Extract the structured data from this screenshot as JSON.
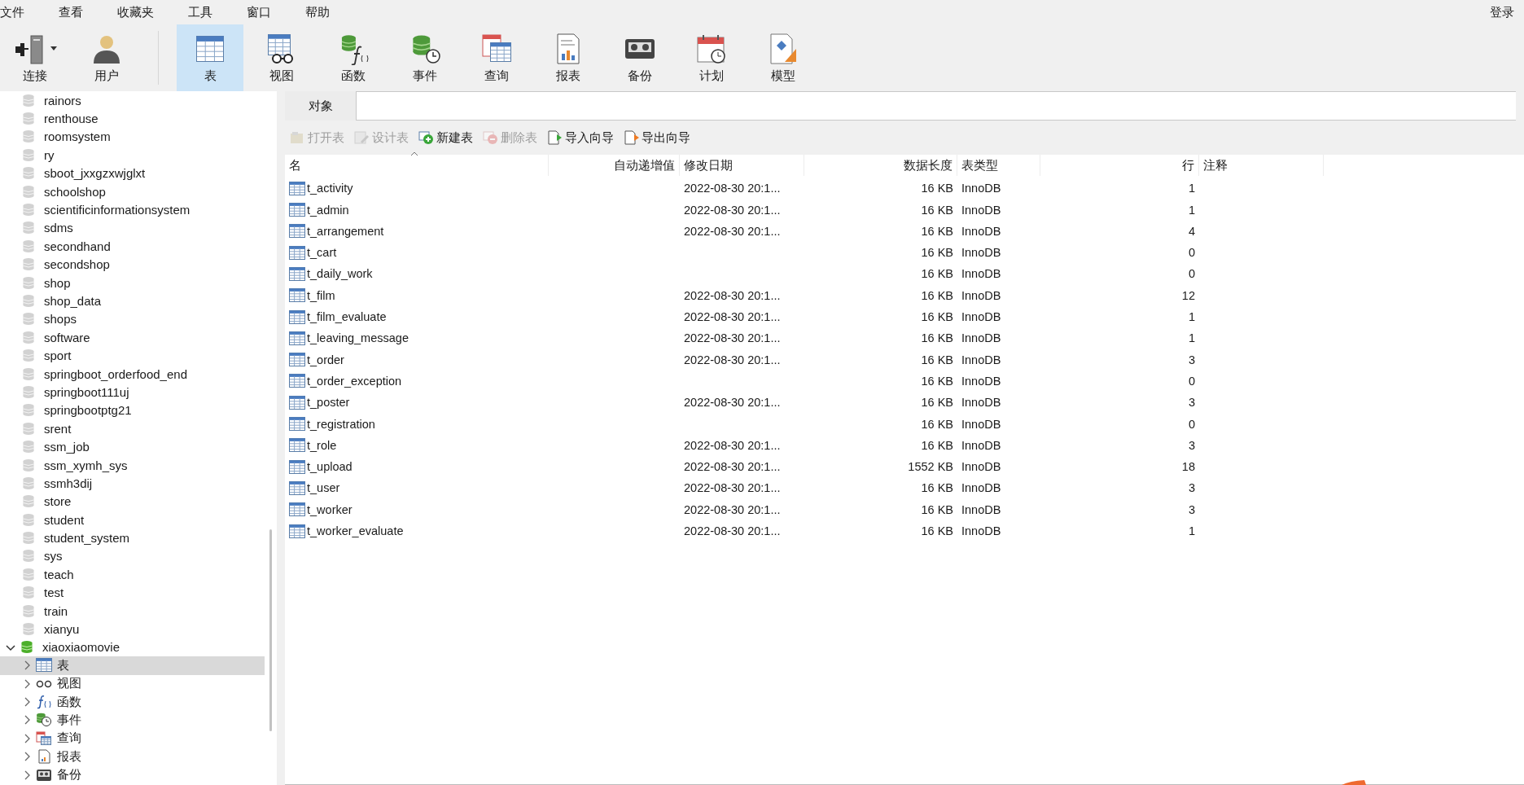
{
  "menu": [
    "文件",
    "查看",
    "收藏夹",
    "工具",
    "窗口",
    "帮助"
  ],
  "account": "登录",
  "toolbar": [
    {
      "label": "连接",
      "kind": "connect",
      "selected": false,
      "dropdown": true
    },
    {
      "label": "用户",
      "kind": "user",
      "selected": false
    },
    {
      "label": "表",
      "kind": "table",
      "selected": true
    },
    {
      "label": "视图",
      "kind": "view",
      "selected": false
    },
    {
      "label": "函数",
      "kind": "function",
      "selected": false
    },
    {
      "label": "事件",
      "kind": "event",
      "selected": false
    },
    {
      "label": "查询",
      "kind": "query",
      "selected": false
    },
    {
      "label": "报表",
      "kind": "report",
      "selected": false
    },
    {
      "label": "备份",
      "kind": "backup",
      "selected": false
    },
    {
      "label": "计划",
      "kind": "schedule",
      "selected": false
    },
    {
      "label": "模型",
      "kind": "model",
      "selected": false
    }
  ],
  "sidebar": {
    "databases": [
      {
        "name": "rainors",
        "expanded": false
      },
      {
        "name": "renthouse",
        "expanded": false
      },
      {
        "name": "roomsystem",
        "expanded": false
      },
      {
        "name": "ry",
        "expanded": false
      },
      {
        "name": "sboot_jxxgzxwjglxt",
        "expanded": false
      },
      {
        "name": "schoolshop",
        "expanded": false
      },
      {
        "name": "scientificinformationsystem",
        "expanded": false
      },
      {
        "name": "sdms",
        "expanded": false
      },
      {
        "name": "secondhand",
        "expanded": false
      },
      {
        "name": "secondshop",
        "expanded": false
      },
      {
        "name": "shop",
        "expanded": false
      },
      {
        "name": "shop_data",
        "expanded": false
      },
      {
        "name": "shops",
        "expanded": false
      },
      {
        "name": "software",
        "expanded": false
      },
      {
        "name": "sport",
        "expanded": false
      },
      {
        "name": "springboot_orderfood_end",
        "expanded": false
      },
      {
        "name": "springboot111uj",
        "expanded": false
      },
      {
        "name": "springbootptg21",
        "expanded": false
      },
      {
        "name": "srent",
        "expanded": false
      },
      {
        "name": "ssm_job",
        "expanded": false
      },
      {
        "name": "ssm_xymh_sys",
        "expanded": false
      },
      {
        "name": "ssmh3dij",
        "expanded": false
      },
      {
        "name": "store",
        "expanded": false
      },
      {
        "name": "student",
        "expanded": false
      },
      {
        "name": "student_system",
        "expanded": false
      },
      {
        "name": "sys",
        "expanded": false
      },
      {
        "name": "teach",
        "expanded": false
      },
      {
        "name": "test",
        "expanded": false
      },
      {
        "name": "train",
        "expanded": false
      },
      {
        "name": "xianyu",
        "expanded": false
      },
      {
        "name": "xiaoxiaomovie",
        "expanded": true,
        "children": [
          {
            "label": "表",
            "kind": "table",
            "selected": true,
            "expanded": false
          },
          {
            "label": "视图",
            "kind": "view",
            "selected": false,
            "expanded": false
          },
          {
            "label": "函数",
            "kind": "function",
            "selected": false,
            "expanded": false
          },
          {
            "label": "事件",
            "kind": "event",
            "selected": false,
            "expanded": false
          },
          {
            "label": "查询",
            "kind": "query",
            "selected": false,
            "expanded": false
          },
          {
            "label": "报表",
            "kind": "report",
            "selected": false,
            "expanded": false
          },
          {
            "label": "备份",
            "kind": "backup",
            "selected": false,
            "expanded": false
          }
        ]
      }
    ]
  },
  "object_tab": {
    "label": "对象",
    "selected": true
  },
  "actions": [
    {
      "label": "打开表",
      "kind": "open",
      "disabled": true
    },
    {
      "label": "设计表",
      "kind": "design",
      "disabled": true
    },
    {
      "label": "新建表",
      "kind": "new",
      "disabled": false
    },
    {
      "label": "删除表",
      "kind": "delete",
      "disabled": true
    },
    {
      "label": "导入向导",
      "kind": "import",
      "disabled": false
    },
    {
      "label": "导出向导",
      "kind": "export",
      "disabled": false
    }
  ],
  "table": {
    "columns": [
      "名",
      "自动递增值",
      "修改日期",
      "数据长度",
      "表类型",
      "行",
      "注释"
    ],
    "rows": [
      {
        "name": "t_activity",
        "modified": "2022-08-30 20:1...",
        "data_length": "16 KB",
        "engine": "InnoDB",
        "rows": "1"
      },
      {
        "name": "t_admin",
        "modified": "2022-08-30 20:1...",
        "data_length": "16 KB",
        "engine": "InnoDB",
        "rows": "1"
      },
      {
        "name": "t_arrangement",
        "modified": "2022-08-30 20:1...",
        "data_length": "16 KB",
        "engine": "InnoDB",
        "rows": "4"
      },
      {
        "name": "t_cart",
        "data_length": "16 KB",
        "engine": "InnoDB",
        "rows": "0"
      },
      {
        "name": "t_daily_work",
        "data_length": "16 KB",
        "engine": "InnoDB",
        "rows": "0"
      },
      {
        "name": "t_film",
        "modified": "2022-08-30 20:1...",
        "data_length": "16 KB",
        "engine": "InnoDB",
        "rows": "12"
      },
      {
        "name": "t_film_evaluate",
        "modified": "2022-08-30 20:1...",
        "data_length": "16 KB",
        "engine": "InnoDB",
        "rows": "1"
      },
      {
        "name": "t_leaving_message",
        "modified": "2022-08-30 20:1...",
        "data_length": "16 KB",
        "engine": "InnoDB",
        "rows": "1"
      },
      {
        "name": "t_order",
        "modified": "2022-08-30 20:1...",
        "data_length": "16 KB",
        "engine": "InnoDB",
        "rows": "3"
      },
      {
        "name": "t_order_exception",
        "data_length": "16 KB",
        "engine": "InnoDB",
        "rows": "0"
      },
      {
        "name": "t_poster",
        "modified": "2022-08-30 20:1...",
        "data_length": "16 KB",
        "engine": "InnoDB",
        "rows": "3"
      },
      {
        "name": "t_registration",
        "data_length": "16 KB",
        "engine": "InnoDB",
        "rows": "0"
      },
      {
        "name": "t_role",
        "modified": "2022-08-30 20:1...",
        "data_length": "16 KB",
        "engine": "InnoDB",
        "rows": "3"
      },
      {
        "name": "t_upload",
        "modified": "2022-08-30 20:1...",
        "data_length": "1552 KB",
        "engine": "InnoDB",
        "rows": "18"
      },
      {
        "name": "t_user",
        "modified": "2022-08-30 20:1...",
        "data_length": "16 KB",
        "engine": "InnoDB",
        "rows": "3"
      },
      {
        "name": "t_worker",
        "modified": "2022-08-30 20:1...",
        "data_length": "16 KB",
        "engine": "InnoDB",
        "rows": "3"
      },
      {
        "name": "t_worker_evaluate",
        "modified": "2022-08-30 20:1...",
        "data_length": "16 KB",
        "engine": "InnoDB",
        "rows": "1"
      }
    ]
  }
}
